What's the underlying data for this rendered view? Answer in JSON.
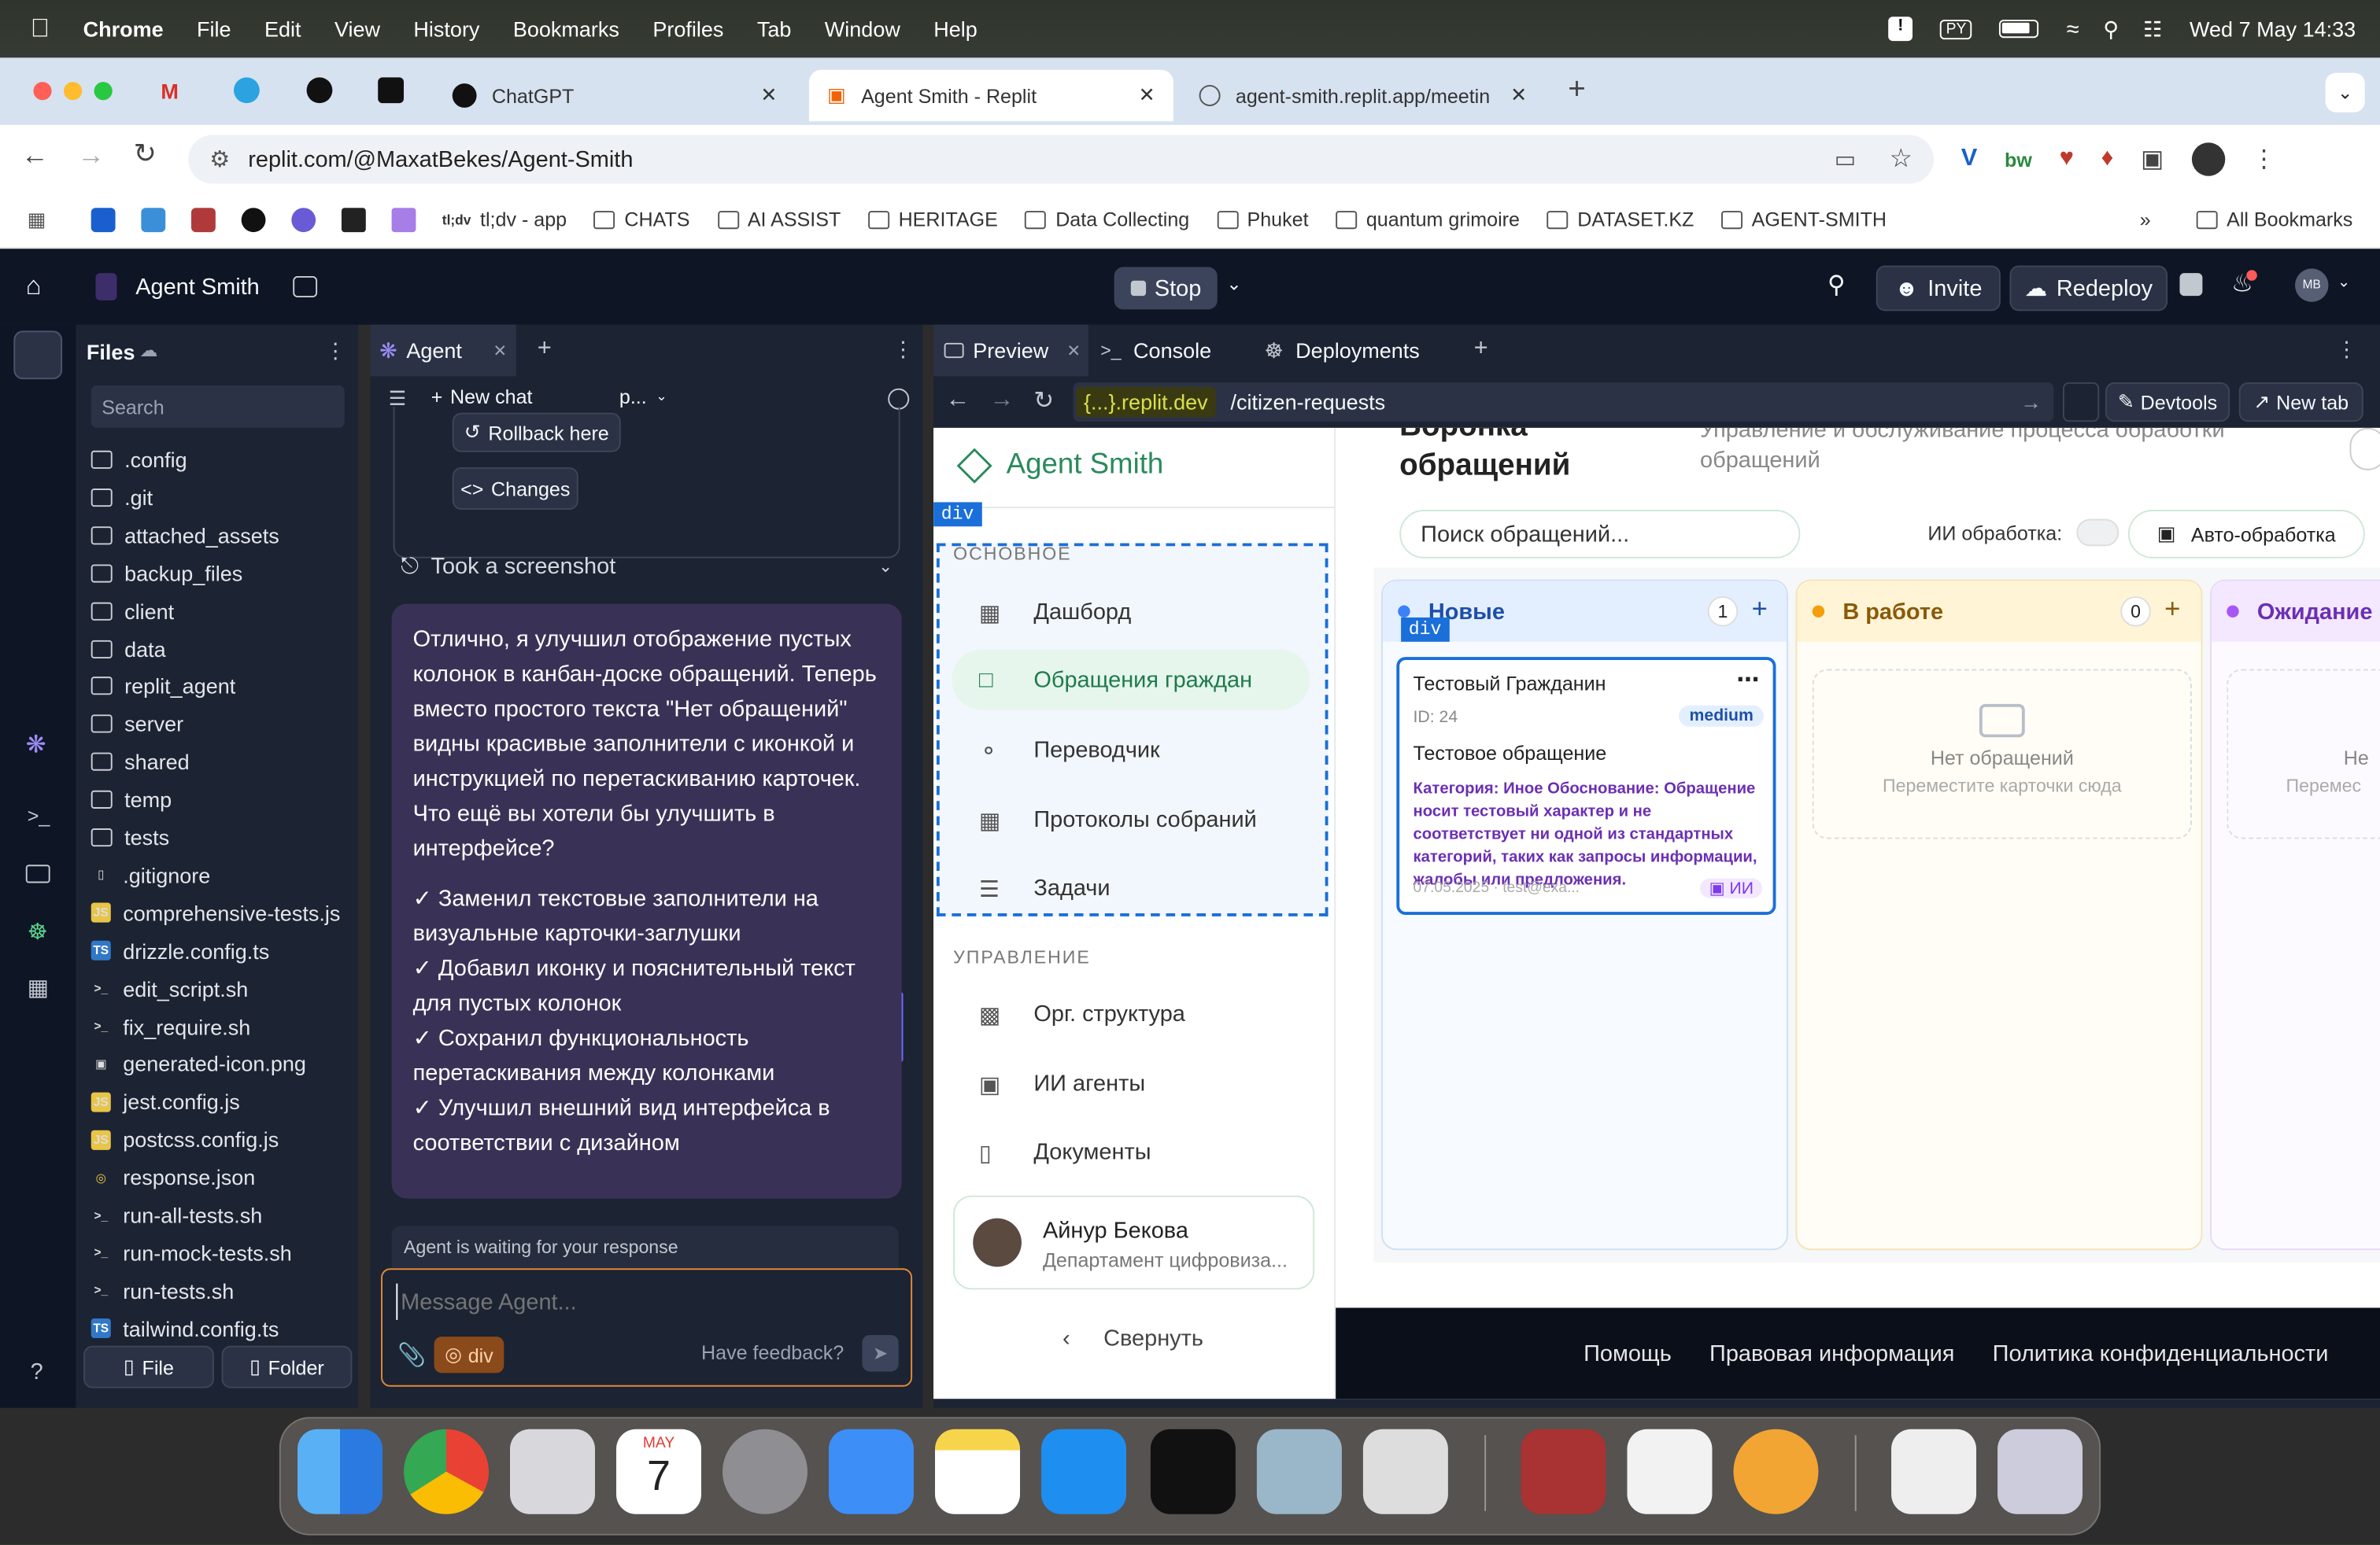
{
  "menubar": {
    "browser": "Chrome",
    "items": [
      "File",
      "Edit",
      "View",
      "History",
      "Bookmarks",
      "Profiles",
      "Tab",
      "Window",
      "Help"
    ],
    "lang": "PY",
    "datetime": "Wed 7 May  14:33"
  },
  "tabs": [
    {
      "label": "ChatGPT"
    },
    {
      "label": "Agent Smith - Replit"
    },
    {
      "label": "agent-smith.replit.app/meetin"
    }
  ],
  "url": "replit.com/@MaxatBekes/Agent-Smith",
  "bookmarks": [
    "tl;dv - app",
    "CHATS",
    "AI ASSIST",
    "HERITAGE",
    "Data Collecting",
    "Phuket",
    "quantum grimoire",
    "DATASET.KZ",
    "AGENT-SMITH"
  ],
  "all_bookmarks": "All Bookmarks",
  "replit": {
    "project": "Agent Smith",
    "stop": "Stop",
    "invite": "Invite",
    "redeploy": "Redeploy",
    "avatar": "MB"
  },
  "files": {
    "title": "Files",
    "search": "Search",
    "items": [
      ".config",
      ".git",
      "attached_assets",
      "backup_files",
      "client",
      "data",
      "replit_agent",
      "server",
      "shared",
      "temp",
      "tests",
      ".gitignore",
      "comprehensive-tests.js",
      "drizzle.config.ts",
      "edit_script.sh",
      "fix_require.sh",
      "generated-icon.png",
      "jest.config.js",
      "postcss.config.js",
      "response.json",
      "run-all-tests.sh",
      "run-mock-tests.sh",
      "run-tests.sh",
      "tailwind.config.ts"
    ],
    "file_btn": "File",
    "folder_btn": "Folder"
  },
  "agent": {
    "tab": "Agent",
    "new_chat": "New chat",
    "model": "p...",
    "rollback": "Rollback here",
    "changes": "Changes",
    "screenshot": "Took a screenshot",
    "message": "Отлично, я улучшил отображение пустых колонок в канбан-доске обращений. Теперь вместо простого текста \"Нет обращений\" видны красивые заполнители с иконкой и инструкцией по перетаскиванию карточек. Что ещё вы хотели бы улучшить в интерфейсе?",
    "bullets": [
      "✓ Заменил текстовые заполнители на визуальные карточки-заглушки",
      "✓ Добавил иконку и пояснительный текст для пустых колонок",
      "✓ Сохранил функциональность перетаскивания между колонками",
      "✓ Улучшил внешний вид интерфейса в соответствии с дизайном"
    ],
    "waiting": "Agent is waiting for your response",
    "placeholder": "Message Agent...",
    "chip": "div",
    "feedback": "Have feedback?"
  },
  "preview": {
    "tabs": [
      "Preview",
      "Console",
      "Deployments"
    ],
    "domain": "{...}.replit.dev",
    "path": "/citizen-requests",
    "devtools": "Devtools",
    "newtab": "New tab"
  },
  "web": {
    "logo": "Agent Smith",
    "section1": "ОСНОВНОЕ",
    "nav1": [
      "Дашборд",
      "Обращения граждан",
      "Переводчик",
      "Протоколы собраний",
      "Задачи"
    ],
    "section2": "УПРАВЛЕНИЕ",
    "nav2": [
      "Орг. структура",
      "ИИ агенты",
      "Документы"
    ],
    "user_name": "Айнур Бекова",
    "user_dept": "Департамент цифровиза...",
    "collapse": "Свернуть",
    "title_l1": "Воронка",
    "title_l2": "обращений",
    "subtitle_l1": "Управление и обслуживание процесса обработки",
    "subtitle_l2": "обращений",
    "search_placeholder": "Поиск обращений...",
    "ai_label": "ИИ обработка:",
    "auto": "Авто-обработка",
    "columns": [
      {
        "title": "Новые",
        "count": "1",
        "color": "#3b82f6"
      },
      {
        "title": "В работе",
        "count": "0",
        "color": "#f59e0b"
      },
      {
        "title": "Ожидание",
        "count": "",
        "color": "#a855f7"
      }
    ],
    "card": {
      "name": "Тестовый Гражданин",
      "id": "ID: 24",
      "priority": "medium",
      "subject": "Тестовое обращение",
      "meta": "07.05.2025 · test@exa...",
      "ai": "ИИ",
      "overlay": "Категория: Иное Обоснование: Обращение носит тестовый характер и не соответствует ни одной из стандартных категорий, таких как запросы информации, жалобы или предложения."
    },
    "empty_title": "Нет обращений",
    "empty_hint": "Переместите карточки сюда",
    "empty_title_short": "Не",
    "empty_hint_short": "Перемес",
    "footer": [
      "Помощь",
      "Правовая информация",
      "Политика конфиденциальности"
    ]
  },
  "dock": {
    "calendar_month": "MAY",
    "calendar_day": "7"
  },
  "colors": {
    "replit_bg": "#0e1525",
    "panel": "#1c2333",
    "accent": "#1a6fd9",
    "active_nav": "#e6f6ec"
  }
}
